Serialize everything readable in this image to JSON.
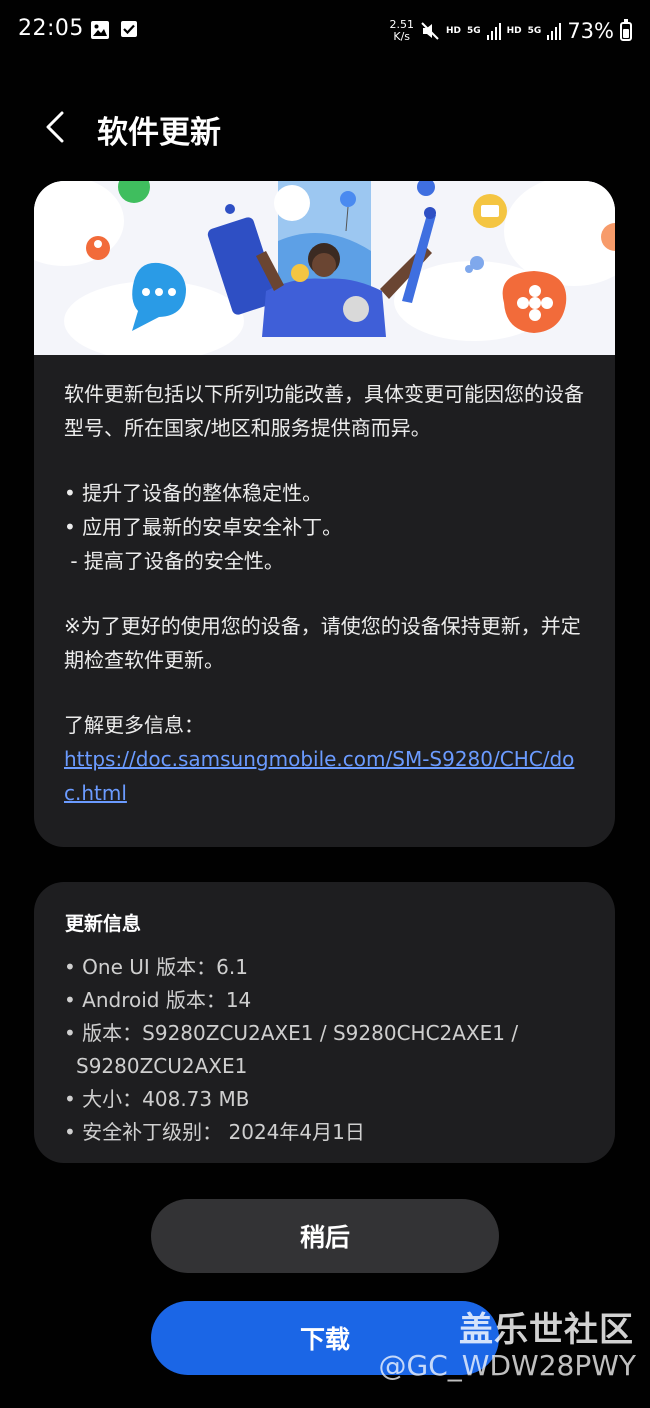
{
  "status_bar": {
    "time": "22:05",
    "speed_value": "2.51",
    "speed_unit": "K/s",
    "hd1": "HD",
    "net1": "5G",
    "hd2": "HD",
    "net2": "5G",
    "battery": "73%"
  },
  "header": {
    "title": "软件更新"
  },
  "description": {
    "intro": "软件更新包括以下所列功能改善，具体变更可能因您的设备型号、所在国家/地区和服务提供商而异。",
    "bullet1": "• 提升了设备的整体稳定性。",
    "bullet2": "• 应用了最新的安卓安全补丁。",
    "bullet2_sub": " - 提高了设备的安全性。",
    "note": "※为了更好的使用您的设备，请使您的设备保持更新，并定期检查软件更新。",
    "more_label": "了解更多信息：",
    "link": "https://doc.samsungmobile.com/SM-S9280/CHC/doc.html"
  },
  "update_info": {
    "title": "更新信息",
    "items": [
      "• One UI 版本：6.1",
      "• Android 版本：14",
      "• 版本：S9280ZCU2AXE1 / S9280CHC2AXE1 / S9280ZCU2AXE1",
      "• 大小：408.73 MB",
      "• 安全补丁级别： 2024年4月1日"
    ]
  },
  "buttons": {
    "later": "稍后",
    "download": "下载"
  },
  "watermark": {
    "site": "盖乐世社区",
    "user": "@GC_WDW28PWY"
  },
  "colors": {
    "background": "#010101",
    "card": "#1e1e20",
    "link": "#6b9bff",
    "download_button": "#1b66e6",
    "later_button": "#333335"
  }
}
